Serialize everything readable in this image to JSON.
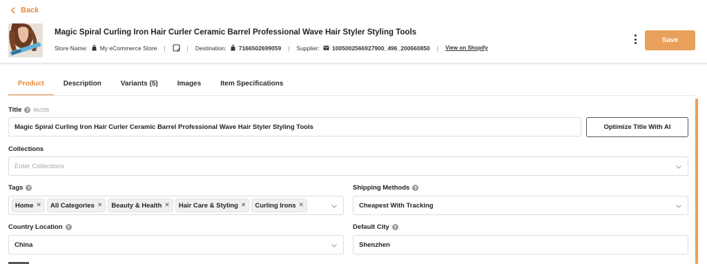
{
  "header": {
    "back_label": "Back",
    "product_title": "Magic Spiral Curling Iron Hair Curler Ceramic Barrel Professional Wave Hair Styler Styling Tools",
    "store_name_label": "Store Name:",
    "store_name_value": "My eCommerce Store",
    "destination_label": "Destination:",
    "destination_value": "7166502699059",
    "supplier_label": "Supplier:",
    "supplier_value": "1005002566927900_496_200660850",
    "view_link": "View on Shopify",
    "save_label": "Save"
  },
  "tabs": [
    {
      "label": "Product",
      "active": true
    },
    {
      "label": "Description",
      "active": false
    },
    {
      "label": "Variants (5)",
      "active": false
    },
    {
      "label": "Images",
      "active": false
    },
    {
      "label": "Item Specifications",
      "active": false
    }
  ],
  "form": {
    "title_label": "Title",
    "title_count": "96/255",
    "title_value": "Magic Spiral Curling Iron Hair Curler Ceramic Barrel Professional Wave Hair Styler Styling Tools",
    "optimize_label": "Optimize Title With AI",
    "collections_label": "Collections",
    "collections_placeholder": "Enter Collections",
    "tags_label": "Tags",
    "tags": [
      "Home",
      "All Categories",
      "Beauty & Health",
      "Hair Care & Styling",
      "Curling Irons"
    ],
    "shipping_label": "Shipping Methods",
    "shipping_value": "Cheapest With Tracking",
    "country_label": "Country Location",
    "country_value": "China",
    "city_label": "Default City",
    "city_value": "Shenzhen"
  },
  "colors": {
    "accent": "#e8893a",
    "save_button": "#e8a05a",
    "scrollbar": "#e8a05a"
  },
  "icons": [
    "chevron-left-icon",
    "bag-icon",
    "note-icon",
    "mail-icon",
    "kebab-menu-icon",
    "help-icon",
    "chevron-down-icon",
    "close-icon"
  ]
}
